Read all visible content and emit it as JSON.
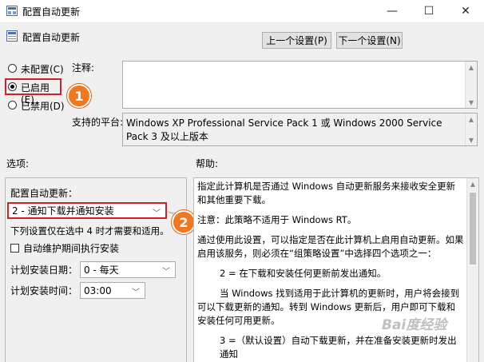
{
  "window": {
    "title": "配置自动更新",
    "minimize": "—",
    "maximize": "☐",
    "close": "✕"
  },
  "header": {
    "title": "配置自动更新",
    "prev_button": "上一个设置(P)",
    "next_button": "下一个设置(N)"
  },
  "state": {
    "options": [
      {
        "label": "未配置(C)",
        "selected": false
      },
      {
        "label": "已启用(E)",
        "selected": true
      },
      {
        "label": "已禁用(D)",
        "selected": false
      }
    ]
  },
  "comment": {
    "label": "注释:",
    "value": ""
  },
  "platform": {
    "label": "支持的平台:",
    "value": "Windows XP Professional Service Pack 1 或 Windows 2000 Service Pack 3 及以上版本"
  },
  "options_panel": {
    "header": "选项:",
    "configure_label": "配置自动更新：",
    "configure_value": "2 - 通知下载并通知安装",
    "note": "下列设置仅在选中 4 时才需要和适用。",
    "maintenance_checkbox": "自动维护期间执行安装",
    "install_day_label": "计划安装日期：",
    "install_day_value": "0 - 每天",
    "install_time_label": "计划安装时间：",
    "install_time_value": "03:00"
  },
  "help_panel": {
    "header": "帮助:",
    "paragraphs": [
      "指定此计算机是否通过 Windows 自动更新服务来接收安全更新和其他重要下载。",
      "注意：此策略不适用于 Windows RT。",
      "通过使用此设置，可以指定是否在此计算机上启用自动更新。如果启用该服务，则必须在“组策略设置”中选择四个选项之一：",
      "2 = 在下载和安装任何更新前发出通知。",
      "当 Windows 找到适用于此计算机的更新时，用户将会接到可以下载更新的通知。转到 Windows 更新后，用户即可下载和安装任何可用更新。",
      "3 =（默认设置）自动下载更新，并在准备安装更新时发出通知"
    ]
  },
  "annotations": {
    "badge1": "1",
    "badge2": "2"
  },
  "watermark": "Bai度经验",
  "colors": {
    "highlight": "#d0202a",
    "badge": "#f07820"
  }
}
